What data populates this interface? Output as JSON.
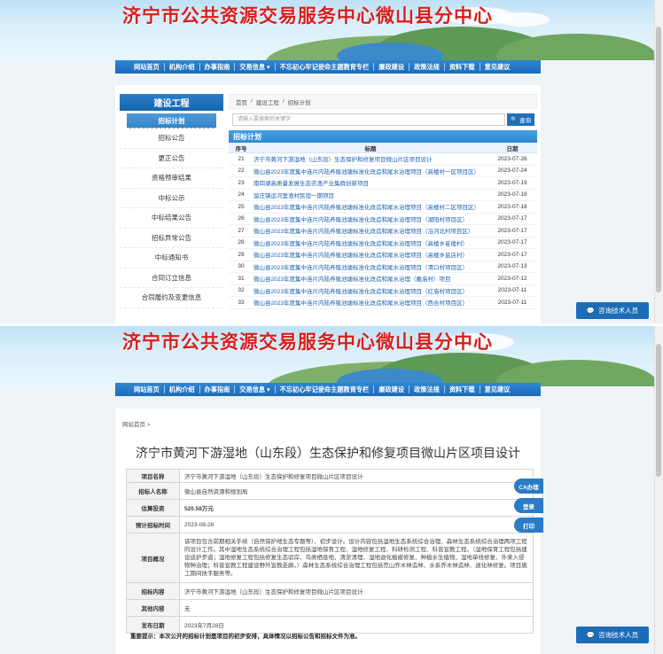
{
  "site": {
    "title": "济宁市公共资源交易服务中心微山县分中心",
    "nav": [
      "网站首页",
      "机构介绍",
      "办事指南",
      "交易信息 ▾",
      "不忘初心牢记使命主题教育专栏",
      "廉政建设",
      "政策法规",
      "资料下载",
      "意见建议"
    ]
  },
  "list_page": {
    "sidebar": {
      "title": "建设工程",
      "items": [
        "招标计划",
        "招标公告",
        "更正公告",
        "资格预审结果",
        "中标公示",
        "中标结果公告",
        "招标异常公告",
        "中标通知书",
        "合同订立信息",
        "合同履约及变更信息"
      ]
    },
    "breadcrumb": [
      "首页",
      "/",
      "建设工程",
      "/",
      "招标计划"
    ],
    "search": {
      "placeholder": "请输入要搜索的关键字",
      "button": "查询"
    },
    "table_title": "招标计划",
    "columns": [
      "序号",
      "标题",
      "日期"
    ],
    "rows": [
      {
        "no": "21",
        "title": "济宁市黄河下游湿地（山东段）生态保护和修复项目微山片区项目设计",
        "date": "2023-07-28"
      },
      {
        "no": "22",
        "title": "微山县2023年度集中连片内陆养殖池塘标准化改造和尾水治理项目（高楼村一区项目区）",
        "date": "2023-07-24"
      },
      {
        "no": "23",
        "title": "南四湖高质量发展生态农渔产业集群创新项目",
        "date": "2023-07-19"
      },
      {
        "no": "24",
        "title": "留庄镇运河里渔村民宿一期项目",
        "date": "2023-07-18"
      },
      {
        "no": "25",
        "title": "微山县2023年度集中连片内陆养殖池塘标准化改造和尾水治理项目（高楼村二区项目区）",
        "date": "2023-07-18"
      },
      {
        "no": "26",
        "title": "微山县2023年度集中连片内陆养殖池塘标准化改造和尾水治理项目（湖阳村项目区）",
        "date": "2023-07-17"
      },
      {
        "no": "27",
        "title": "微山县2023年度集中连片内陆养殖池塘标准化改造和尾水治理项目（沿河北村项目区）",
        "date": "2023-07-17"
      },
      {
        "no": "28",
        "title": "微山县2023年度集中连片内陆养殖池塘标准化改造和尾水治理项目（高楼乡崔楼村）",
        "date": "2023-07-17"
      },
      {
        "no": "29",
        "title": "微山县2023年度集中连片内陆养殖池塘标准化改造和尾水治理项目（高楼乡盐店村）",
        "date": "2023-07-17"
      },
      {
        "no": "30",
        "title": "微山县2023年度集中连片内陆养殖池塘标准化改造和尾水治理项目（渭口村项目区）",
        "date": "2023-07-13"
      },
      {
        "no": "31",
        "title": "微山县2023年度集中连片内陆养殖池塘标准化改造和尾水治理（戴庙村）项目",
        "date": "2023-07-12"
      },
      {
        "no": "32",
        "title": "微山县2023年度集中连片内陆养殖池塘标准化改造和尾水治理项目（红庙村项目区）",
        "date": "2023-07-11"
      },
      {
        "no": "33",
        "title": "微山县2023年度集中连片内陆养殖池塘标准化改造和尾水治理项目（西合村项目区）",
        "date": "2023-07-11"
      }
    ],
    "help_button": "咨询技术人员"
  },
  "detail_page": {
    "breadcrumb": "网站首页 >",
    "title": "济宁市黄河下游湿地（山东段）生态保护和修复项目微山片区项目设计",
    "fields": [
      {
        "key": "项目名称",
        "value": "济宁市黄河下游湿地（山东段）生态保护和修复项目微山片区项目设计"
      },
      {
        "key": "招标人名称",
        "value": "微山县自然资源和规划局"
      },
      {
        "key": "估算投资",
        "value": "520.58万元"
      },
      {
        "key": "预计招标时间",
        "value": "2023-08-28"
      },
      {
        "key": "项目概况",
        "value": "该项目包含前期相关手续（自然保护地生态专题等）、初步设计。设计内容包括湿地生态系统综合治理、森林生态系统综合治理两项工程的设计工作。其中湿地生态系统综合治理工程包括湿地保育工程、湿地修复工程、科研检测工程、科普宣教工程。（湿地保育工程包括建设巡护步道；湿地修复工程包括修复生态驳岸、鸟类栖息地、清淤清理、湿地退化植被修复、种植水生植物、湿地单线修复、外来入侵物种治理；科普宣教工程建设野外宣教走廊。）森林生态系统综合治理工程包括荒山乔木林造林、水系乔木林造林、退化林修复。项目施工期间扶手服务等。"
      },
      {
        "key": "招标内容",
        "value": "济宁市黄河下游湿地（山东段）生态保护和修复项目微山片区项目设计"
      },
      {
        "key": "其他内容",
        "value": "无"
      },
      {
        "key": "发布日期",
        "value": "2023年7月28日"
      }
    ],
    "notice_label": "重要提示：",
    "notice_text": "本次公开的招标计划是项目的初步安排，具体情况以招标公告和招标文件为准。",
    "float_buttons": [
      "CA办理",
      "登录",
      "打印"
    ],
    "help_button": "咨询技术人员"
  }
}
